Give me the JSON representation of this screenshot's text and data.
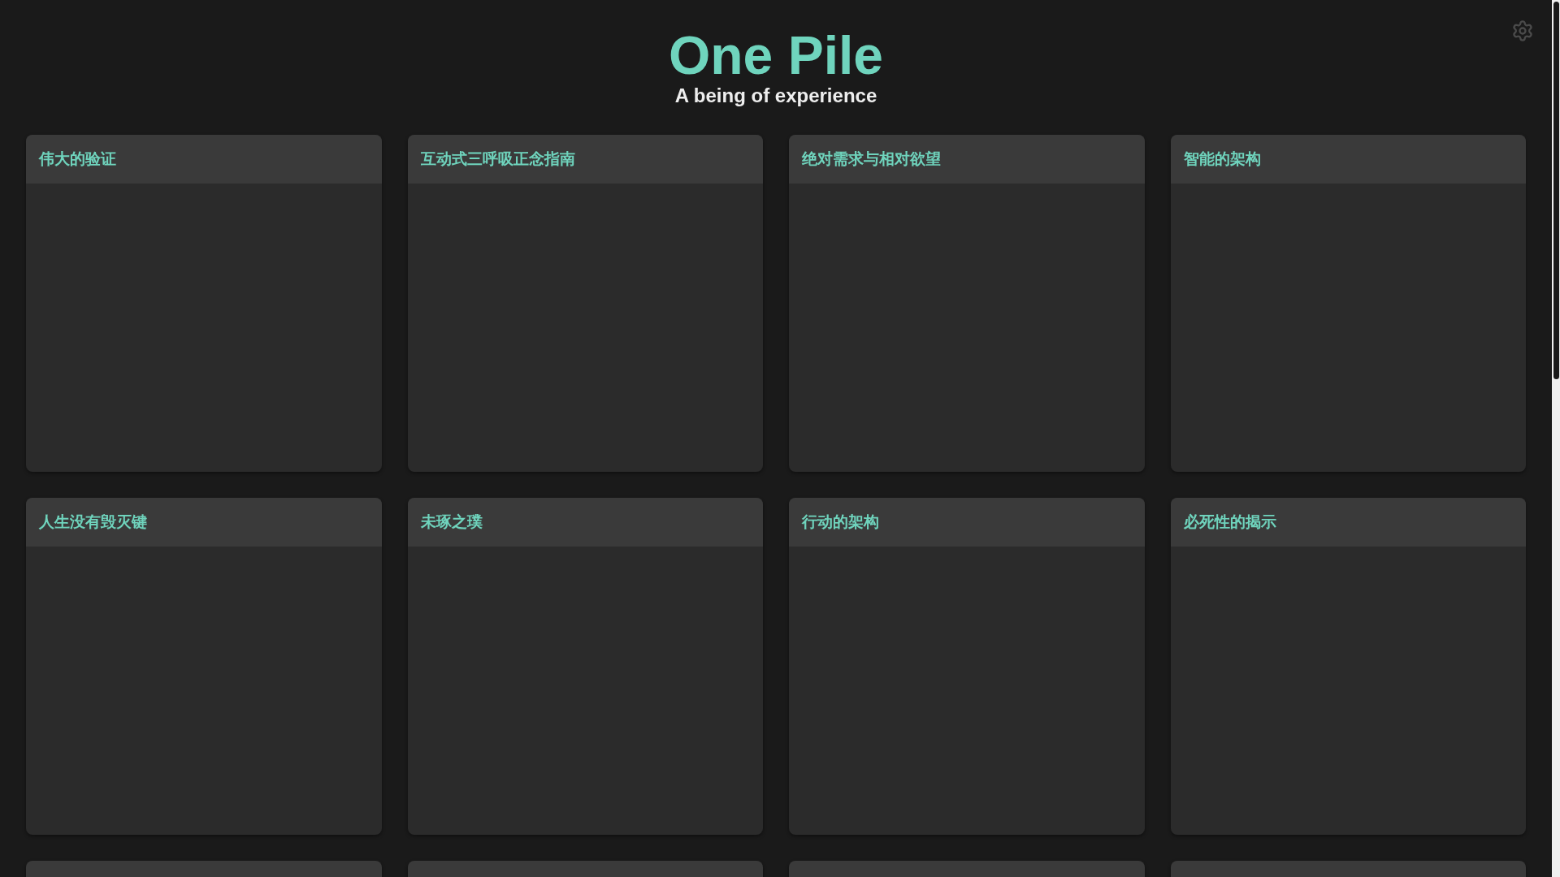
{
  "header": {
    "title": "One Pile",
    "subtitle": "A being of experience"
  },
  "cards": [
    {
      "kind": "full",
      "title": "伟大的验证"
    },
    {
      "kind": "full",
      "title": "互动式三呼吸正念指南"
    },
    {
      "kind": "full",
      "title": "绝对需求与相对欲望"
    },
    {
      "kind": "full",
      "title": "智能的架构"
    },
    {
      "kind": "full",
      "title": "人生没有毁灭键"
    },
    {
      "kind": "full",
      "title": "未琢之璞"
    },
    {
      "kind": "full",
      "title": "行动的架构"
    },
    {
      "kind": "full",
      "title": "必死性的揭示"
    },
    {
      "kind": "cut"
    },
    {
      "kind": "cut"
    },
    {
      "kind": "cut"
    },
    {
      "kind": "cut"
    }
  ]
}
